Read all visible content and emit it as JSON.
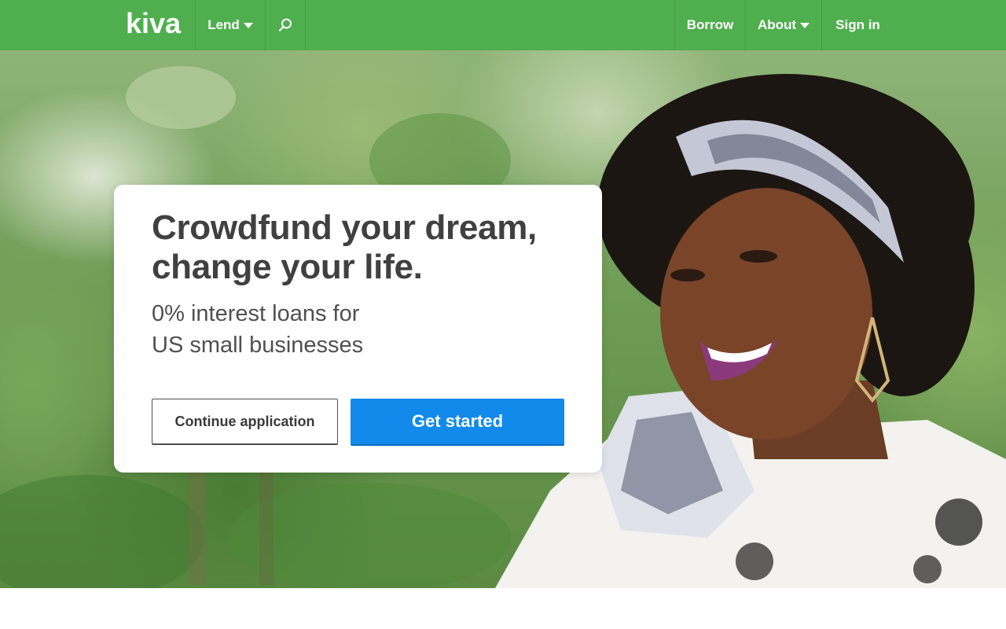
{
  "header": {
    "logo_text": "kiva",
    "nav_left": [
      {
        "label": "Lend",
        "has_dropdown": true
      }
    ],
    "search_icon": "search-icon",
    "nav_right": [
      {
        "label": "Borrow",
        "has_dropdown": false
      },
      {
        "label": "About",
        "has_dropdown": true
      },
      {
        "label": "Sign in",
        "has_dropdown": false
      }
    ]
  },
  "hero": {
    "headline": "Crowdfund your dream, change your life.",
    "subhead_line1": "0% interest loans for",
    "subhead_line2": "US small businesses",
    "continue_label": "Continue application",
    "start_label": "Get started"
  },
  "colors": {
    "brand_green": "#4faf4e",
    "cta_blue": "#118aec",
    "text_dark": "#404040"
  }
}
